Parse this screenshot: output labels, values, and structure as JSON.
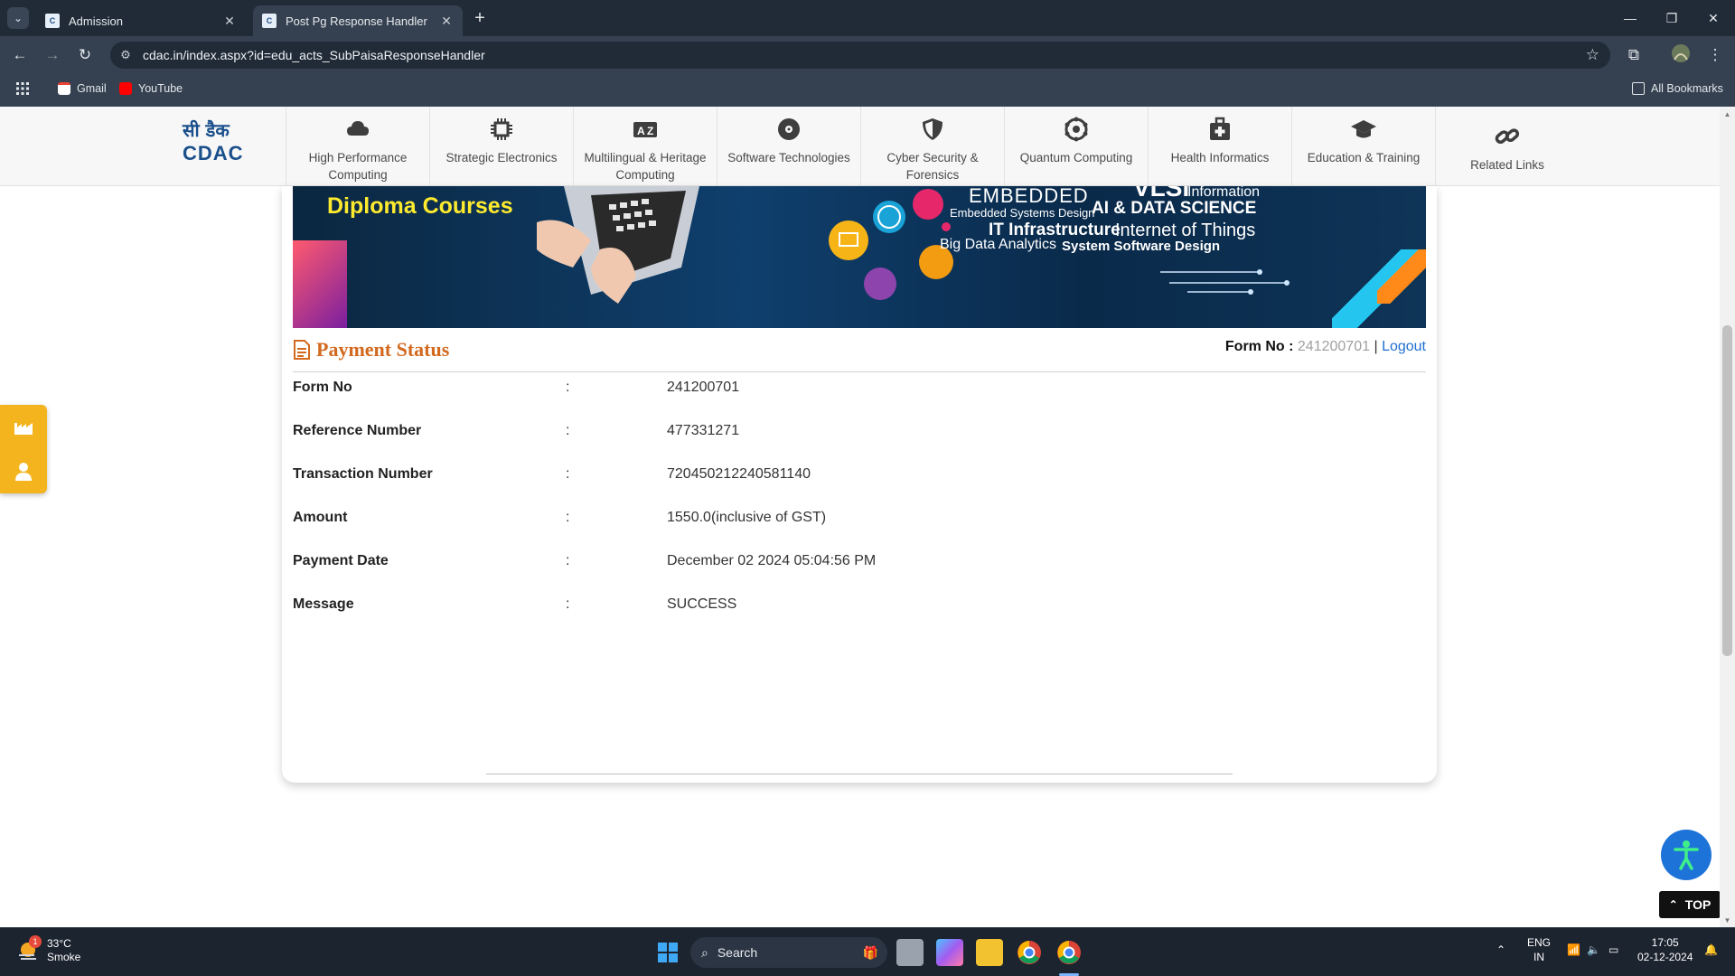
{
  "browser": {
    "tabs": [
      {
        "title": "Admission",
        "active": false
      },
      {
        "title": "Post Pg Response Handler",
        "active": true
      }
    ],
    "url": "cdac.in/index.aspx?id=edu_acts_SubPaisaResponseHandler",
    "bookmarks": [
      "Gmail",
      "YouTube"
    ],
    "all_bookmarks_label": "All Bookmarks"
  },
  "site": {
    "logo_hindi": "सी डैक",
    "logo_english": "CDAC",
    "menu": [
      {
        "label": "High Performance Computing",
        "icon": "cloud-icon"
      },
      {
        "label": "Strategic Electronics",
        "icon": "chip-icon"
      },
      {
        "label": "Multilingual & Heritage Computing",
        "icon": "translate-icon"
      },
      {
        "label": "Software Technologies",
        "icon": "disc-icon"
      },
      {
        "label": "Cyber Security & Forensics",
        "icon": "shield-icon"
      },
      {
        "label": "Quantum Computing",
        "icon": "atom-icon"
      },
      {
        "label": "Health Informatics",
        "icon": "medical-kit-icon"
      },
      {
        "label": "Education & Training",
        "icon": "graduation-cap-icon"
      },
      {
        "label": "Related Links",
        "icon": "link-icon"
      }
    ]
  },
  "banner": {
    "title": "Diploma Courses",
    "keywords": {
      "embedded": "EMBEDDED",
      "vlsi": "VLSI",
      "information": "Information",
      "embedded_systems": "Embedded Systems Design",
      "ai": "AI & DATA SCIENCE",
      "it_infra": "IT Infrastructure",
      "iot": "Internet of Things",
      "big_data": "Big Data Analytics",
      "system_software": "System Software Design"
    }
  },
  "payment": {
    "heading": "Payment Status",
    "form_no_label": "Form No :",
    "form_no_value": "241200701",
    "separator": "|",
    "logout_label": "Logout",
    "colon": ":",
    "rows": [
      {
        "label": "Form No",
        "value": "241200701"
      },
      {
        "label": "Reference Number",
        "value": "477331271"
      },
      {
        "label": "Transaction Number",
        "value": "720450212240581140"
      },
      {
        "label": "Amount",
        "value": "1550.0(inclusive of GST)"
      },
      {
        "label": "Payment Date",
        "value": "December 02 2024 05:04:56 PM"
      },
      {
        "label": "Message",
        "value": "SUCCESS"
      }
    ]
  },
  "widgets": {
    "top_label": "TOP"
  },
  "taskbar": {
    "weather_temp": "33°C",
    "weather_condition": "Smoke",
    "weather_badge": "1",
    "search_label": "Search",
    "language": "ENG",
    "region": "IN",
    "time": "17:05",
    "date": "02-12-2024"
  },
  "colors": {
    "accent_orange": "#d2691e",
    "link_blue": "#1f6fd1",
    "widget_yellow": "#f3b41e",
    "accessibility_blue": "#1e73d8"
  }
}
